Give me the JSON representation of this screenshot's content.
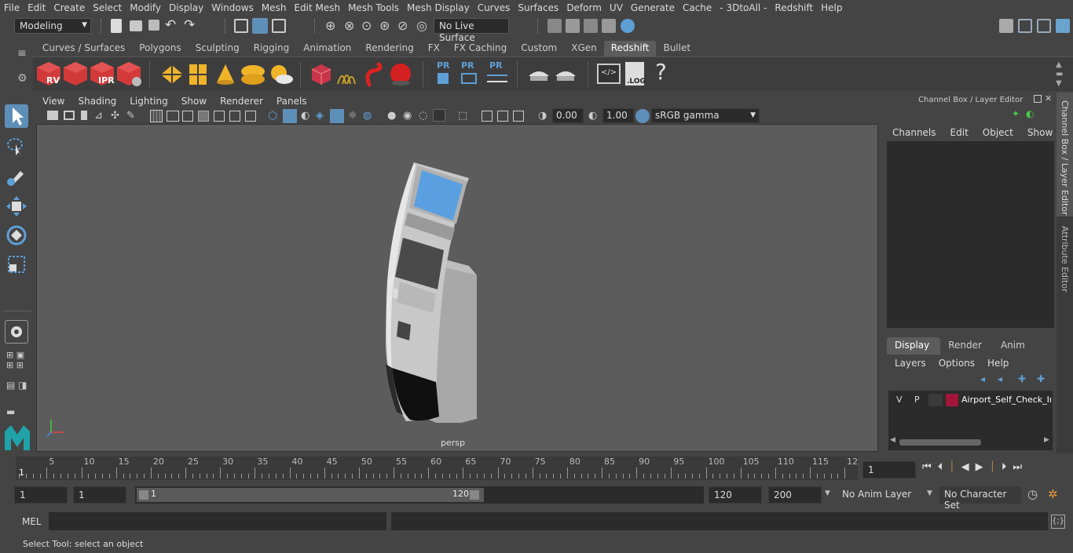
{
  "menubar": {
    "items": [
      "File",
      "Edit",
      "Create",
      "Select",
      "Modify",
      "Display",
      "Windows",
      "Mesh",
      "Edit Mesh",
      "Mesh Tools",
      "Mesh Display",
      "Curves",
      "Surfaces",
      "Deform",
      "UV",
      "Generate",
      "Cache",
      "- 3DtoAll -",
      "Redshift",
      "Help"
    ]
  },
  "statusline": {
    "mode": "Modeling",
    "live_surface": "No Live Surface"
  },
  "shelf": {
    "tabs": [
      "Curves / Surfaces",
      "Polygons",
      "Sculpting",
      "Rigging",
      "Animation",
      "Rendering",
      "FX",
      "FX Caching",
      "Custom",
      "XGen",
      "Redshift",
      "Bullet"
    ],
    "active_tab": "Redshift",
    "icon_labels": {
      "rv": "RV",
      "ipr": "IPR",
      "pr": "PR",
      "log": ".LOG",
      "help": "?"
    }
  },
  "panel": {
    "menus": [
      "View",
      "Shading",
      "Lighting",
      "Show",
      "Renderer",
      "Panels"
    ],
    "exposure": "0.00",
    "gamma": "1.00",
    "colorspace": "sRGB gamma",
    "camera_label": "persp"
  },
  "channelbox": {
    "title": "Channel Box / Layer Editor",
    "menus": [
      "Channels",
      "Edit",
      "Object",
      "Show"
    ],
    "layer_tabs": [
      "Display",
      "Render",
      "Anim"
    ],
    "active_layer_tab": "Display",
    "layer_menus": [
      "Layers",
      "Options",
      "Help"
    ],
    "layer": {
      "v": "V",
      "p": "P",
      "name": "Airport_Self_Check_In",
      "color": "#a3163a"
    },
    "side_tabs": [
      "Channel Box / Layer Editor",
      "Attribute Editor"
    ]
  },
  "timeline": {
    "ticks": [
      "5",
      "10",
      "15",
      "20",
      "25",
      "30",
      "35",
      "40",
      "45",
      "50",
      "55",
      "60",
      "65",
      "70",
      "75",
      "80",
      "85",
      "90",
      "95",
      "100",
      "105",
      "110",
      "115",
      "12"
    ],
    "start_marker": "1",
    "current_frame": "1"
  },
  "range": {
    "start": "1",
    "start2": "1",
    "slider_start": "1",
    "slider_end": "120",
    "end": "120",
    "end2": "200",
    "anim_layer": "No Anim Layer",
    "char_set": "No Character Set"
  },
  "cmd": {
    "label": "MEL"
  },
  "help": {
    "text": "Select Tool: select an object"
  },
  "colors": {
    "accent": "#5e9fd6",
    "screen": "#5aa0e0",
    "redshift_red": "#d23a3a"
  }
}
